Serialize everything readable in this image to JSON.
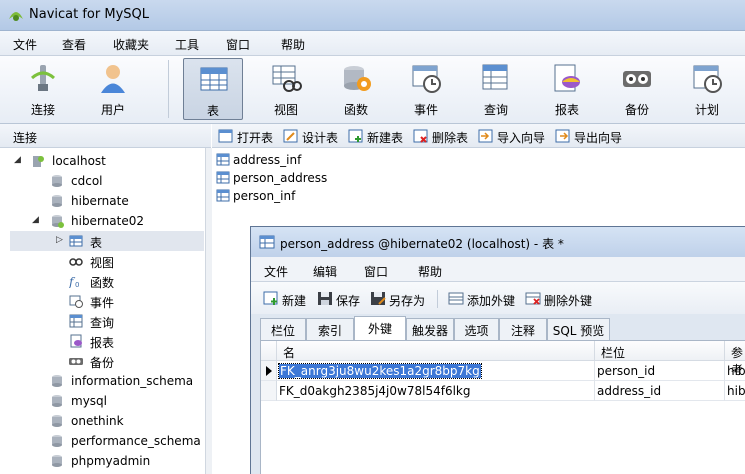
{
  "app": {
    "title": "Navicat for MySQL"
  },
  "menu": [
    "文件",
    "查看",
    "收藏夹",
    "工具",
    "窗口",
    "帮助"
  ],
  "toolbar": {
    "left": [
      {
        "label": "连接",
        "icon": "connection-icon"
      },
      {
        "label": "用户",
        "icon": "user-icon"
      }
    ],
    "main": [
      {
        "label": "表",
        "icon": "table-icon",
        "active": true
      },
      {
        "label": "视图",
        "icon": "view-icon"
      },
      {
        "label": "函数",
        "icon": "function-icon"
      },
      {
        "label": "事件",
        "icon": "event-icon"
      },
      {
        "label": "查询",
        "icon": "query-icon"
      },
      {
        "label": "报表",
        "icon": "report-icon"
      },
      {
        "label": "备份",
        "icon": "backup-icon"
      },
      {
        "label": "计划",
        "icon": "schedule-icon"
      }
    ]
  },
  "sidebar": {
    "header": "连接",
    "tree": [
      {
        "label": "localhost",
        "level": 0,
        "arrow": "◢",
        "icon": "server-icon"
      },
      {
        "label": "cdcol",
        "level": 1,
        "icon": "database-icon"
      },
      {
        "label": "hibernate",
        "level": 1,
        "icon": "database-icon"
      },
      {
        "label": "hibernate02",
        "level": 1,
        "arrow": "◢",
        "icon": "database-open-icon"
      },
      {
        "label": "表",
        "level": 2,
        "arrow": "▷",
        "icon": "table-icon",
        "selected": true
      },
      {
        "label": "视图",
        "level": 2,
        "icon": "view-icon"
      },
      {
        "label": "函数",
        "level": 2,
        "icon": "function-icon"
      },
      {
        "label": "事件",
        "level": 2,
        "icon": "event-icon"
      },
      {
        "label": "查询",
        "level": 2,
        "icon": "query-icon"
      },
      {
        "label": "报表",
        "level": 2,
        "icon": "report-icon"
      },
      {
        "label": "备份",
        "level": 2,
        "icon": "backup-icon"
      },
      {
        "label": "information_schema",
        "level": 1,
        "icon": "database-icon"
      },
      {
        "label": "mysql",
        "level": 1,
        "icon": "database-icon"
      },
      {
        "label": "onethink",
        "level": 1,
        "icon": "database-icon"
      },
      {
        "label": "performance_schema",
        "level": 1,
        "icon": "database-icon"
      },
      {
        "label": "phpmyadmin",
        "level": 1,
        "icon": "database-icon"
      }
    ]
  },
  "object_toolbar": [
    "打开表",
    "设计表",
    "新建表",
    "删除表",
    "导入向导",
    "导出向导"
  ],
  "object_list": [
    "address_inf",
    "person_address",
    "person_inf"
  ],
  "designer": {
    "title": "person_address @hibernate02 (localhost) - 表 *",
    "menu": [
      "文件",
      "编辑",
      "窗口",
      "帮助"
    ],
    "tools": [
      "新建",
      "保存",
      "另存为",
      "添加外键",
      "删除外键"
    ],
    "tabs": [
      "栏位",
      "索引",
      "外键",
      "触发器",
      "选项",
      "注释",
      "SQL 预览"
    ],
    "active_tab": "外键",
    "columns": [
      "名",
      "栏位",
      "参考"
    ],
    "rows": [
      [
        "FK_anrg3ju8wu2kes1a2gr8bp7kg",
        "person_id",
        "hib"
      ],
      [
        "FK_d0akgh2385j4j0w78l54f6lkg",
        "address_id",
        "hib"
      ]
    ]
  }
}
